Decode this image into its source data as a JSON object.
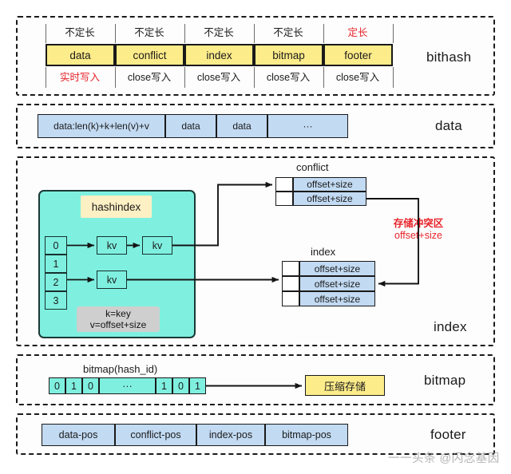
{
  "sections": {
    "bithash": {
      "label": "bithash",
      "columns": [
        {
          "top": "不定长",
          "cell": "data",
          "bottom": "实时写入",
          "top_red": false,
          "bottom_red": true
        },
        {
          "top": "不定长",
          "cell": "conflict",
          "bottom": "close写入",
          "top_red": false,
          "bottom_red": false
        },
        {
          "top": "不定长",
          "cell": "index",
          "bottom": "close写入",
          "top_red": false,
          "bottom_red": false
        },
        {
          "top": "不定长",
          "cell": "bitmap",
          "bottom": "close写入",
          "top_red": false,
          "bottom_red": false
        },
        {
          "top": "定长",
          "cell": "footer",
          "bottom": "close写入",
          "top_red": true,
          "bottom_red": false
        }
      ]
    },
    "data": {
      "label": "data",
      "cells": [
        "data:len(k)+k+len(v)+v",
        "data",
        "data",
        "···"
      ]
    },
    "index": {
      "label": "index",
      "hashindex": {
        "title": "hashindex",
        "buckets": [
          "0",
          "1",
          "2",
          "3"
        ],
        "kv_label": "kv",
        "legend_line1": "k=key",
        "legend_line2": "v=offset+size"
      },
      "conflict_table": {
        "caption": "conflict",
        "rows": [
          "offset+size",
          "offset+size"
        ]
      },
      "index_table": {
        "caption": "index",
        "rows": [
          "offset+size",
          "offset+size",
          "offset+size"
        ]
      },
      "annotation": {
        "line1": "存储冲突区",
        "line2": "offset+size"
      }
    },
    "bitmap": {
      "label": "bitmap",
      "caption": "bitmap(hash_id)",
      "bits": [
        "0",
        "1",
        "0",
        "···",
        "1",
        "0",
        "1"
      ],
      "target": "压缩存储"
    },
    "footer": {
      "label": "footer",
      "cells": [
        "data-pos",
        "conflict-pos",
        "index-pos",
        "bitmap-pos"
      ]
    }
  },
  "watermark": "一一头条 @闪念基因",
  "colors": {
    "yellow": "#fdec8a",
    "blue": "#c2daf2",
    "cyan": "#7ff0e0",
    "red": "#e8232a",
    "gray": "#cfcfcf",
    "stroke": "#1a1a1a"
  }
}
